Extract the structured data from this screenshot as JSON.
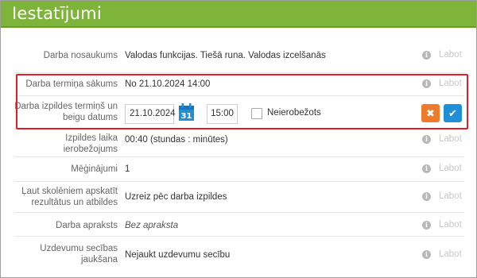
{
  "header": {
    "title": "Iestatījumi"
  },
  "colors": {
    "header_bg": "#7fb43a",
    "highlight_border": "#e11d2a",
    "cancel_btn": "#ee7a2b",
    "confirm_btn": "#1f8fd8",
    "calendar_icon": "#1f8fd8"
  },
  "common": {
    "info_icon": "info-icon",
    "edit_label": "Labot"
  },
  "rows": {
    "task_name": {
      "label": "Darba nosaukums",
      "value": "Valodas funkcijas. Tiešā runa. Valodas izcelšanās"
    },
    "start": {
      "label": "Darba termiņa sākums",
      "value": "No 21.10.2024 14:00"
    },
    "end": {
      "label": "Darba izpildes termiņš un beigu datums",
      "date_value": "21.10.2024",
      "calendar_day": "31",
      "time_value": "15:00",
      "unlimited_label": "Neierobežots",
      "unlimited_checked": false,
      "cancel_icon": "close-icon",
      "confirm_icon": "check-icon"
    },
    "time_limit": {
      "label": "Izpildes laika ierobežojums",
      "value": "00:40 (stundas : minūtes)"
    },
    "attempts": {
      "label": "Mēģinājumi",
      "value": "1"
    },
    "results": {
      "label": "Ļaut skolēniem apskatīt rezultātus un atbildes",
      "value": "Uzreiz pēc darba izpildes"
    },
    "description": {
      "label": "Darba apraksts",
      "value": "Bez apraksta"
    },
    "shuffle": {
      "label": "Uzdevumu secības jaukšana",
      "value": "Nejaukt uzdevumu secību"
    }
  }
}
